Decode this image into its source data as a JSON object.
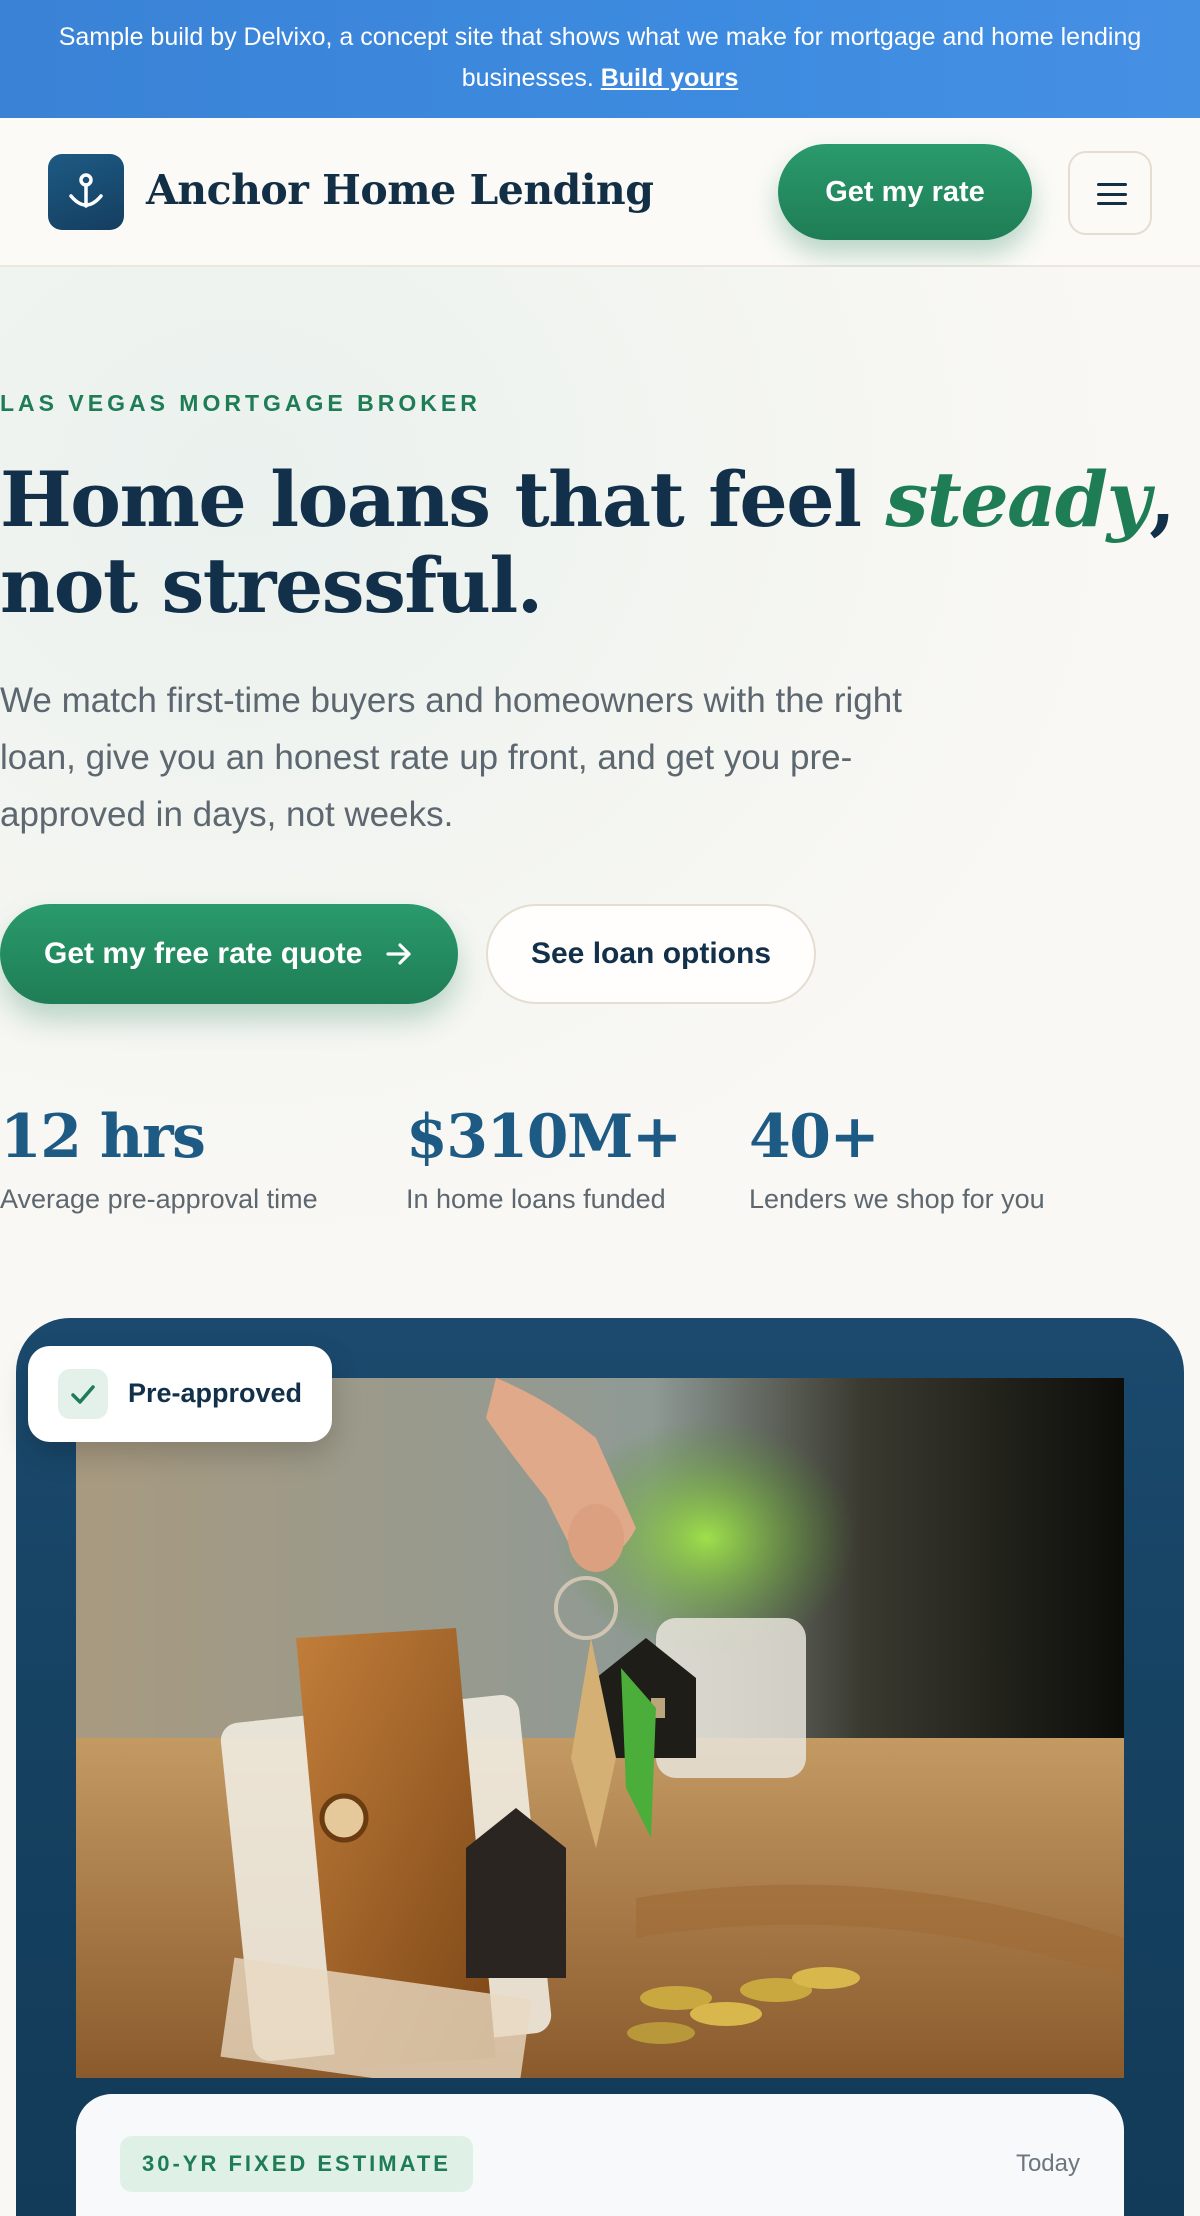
{
  "banner": {
    "text": "Sample build by Delvixo, a concept site that shows what we make for mortgage and home lending businesses.",
    "link": "Build yours"
  },
  "header": {
    "brand": "Anchor Home Lending",
    "logo_icon": "anchor-icon",
    "cta": "Get my rate",
    "menu_icon": "hamburger-menu-icon"
  },
  "hero": {
    "eyebrow": "LAS VEGAS MORTGAGE BROKER",
    "headline_before": "Home loans that feel ",
    "headline_em": "steady",
    "headline_after": ", not stressful.",
    "lede": "We match first-time buyers and homeowners with the right loan, give you an honest rate up front, and get you pre-approved in days, not weeks.",
    "primary_cta": "Get my free rate quote",
    "secondary_cta": "See loan options",
    "stats": [
      {
        "value": "12 hrs",
        "label": "Average pre-approval time"
      },
      {
        "value": "$310M+",
        "label": "In home loans funded"
      },
      {
        "value": "40+",
        "label": "Lenders we shop for you"
      }
    ]
  },
  "card": {
    "badge": "Pre-approved",
    "badge_icon": "check-icon",
    "photo": "hand-holding-house-keys-over-wallet",
    "estimate_label": "30-YR FIXED ESTIMATE",
    "estimate_date": "Today"
  },
  "colors": {
    "accent_green": "#1f7d56",
    "navy": "#12304a",
    "brand_blue": "#1d5a84",
    "banner_blue": "#3d8be0"
  }
}
